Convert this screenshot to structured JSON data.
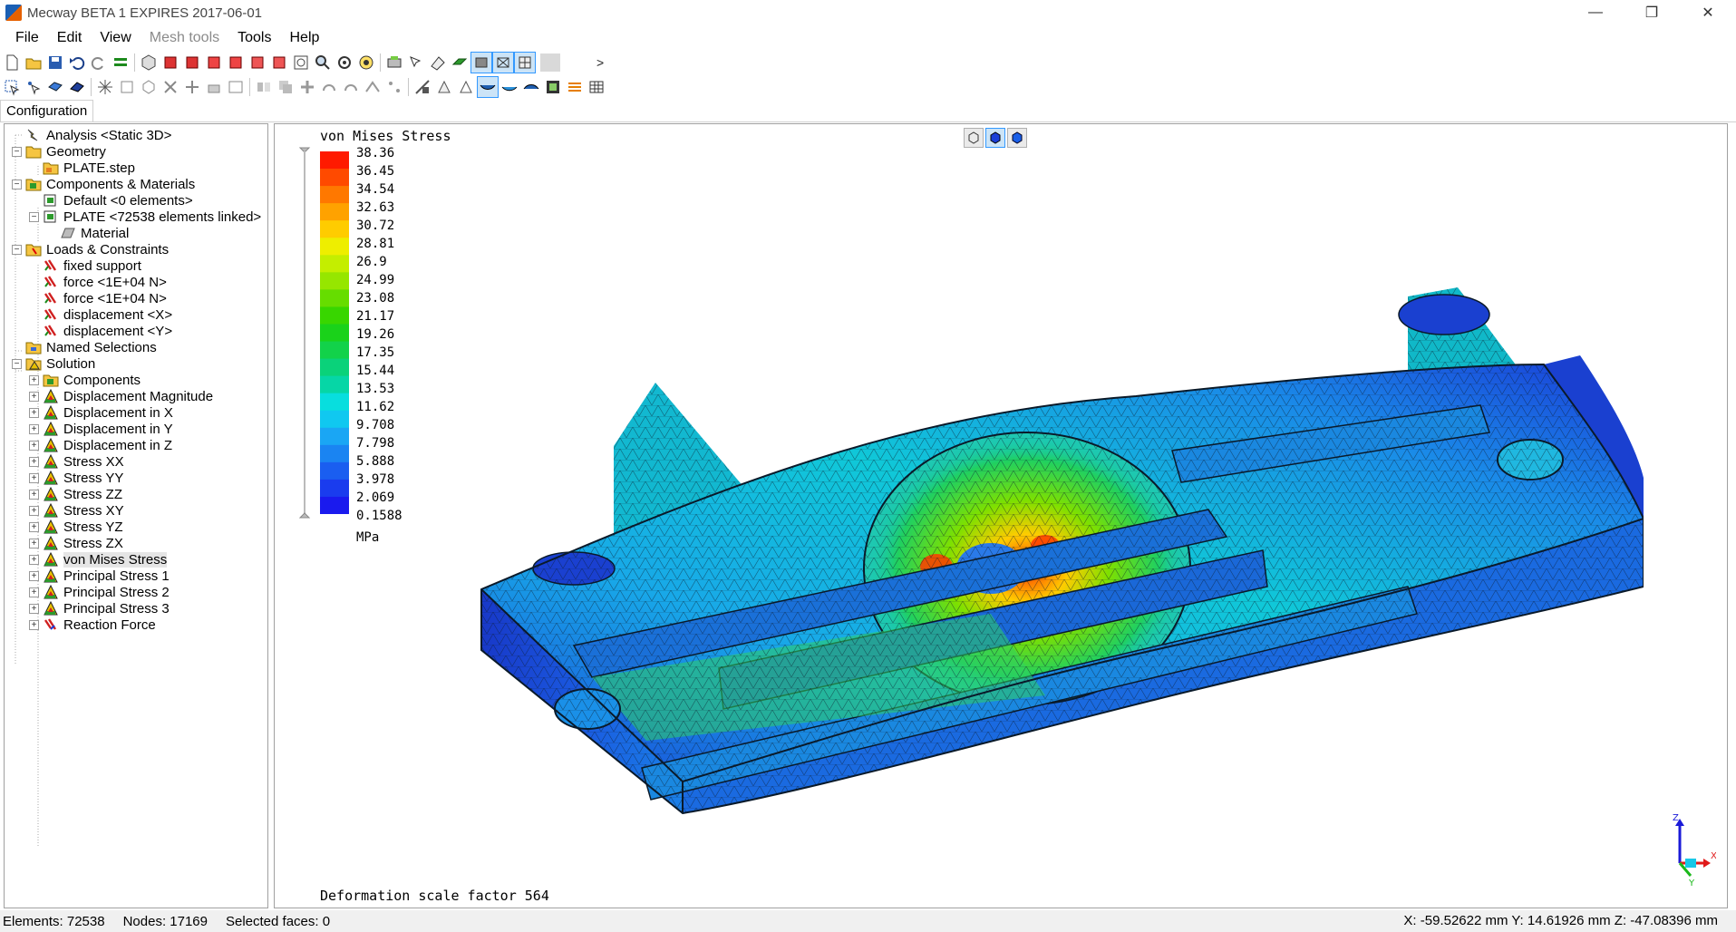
{
  "window": {
    "title": "Mecway BETA 1 EXPIRES 2017-06-01",
    "controls": [
      "—",
      "❐",
      "✕"
    ]
  },
  "menu": [
    {
      "label": "File",
      "enabled": true
    },
    {
      "label": "Edit",
      "enabled": true
    },
    {
      "label": "View",
      "enabled": true
    },
    {
      "label": "Mesh tools",
      "enabled": false
    },
    {
      "label": "Tools",
      "enabled": true
    },
    {
      "label": "Help",
      "enabled": true
    }
  ],
  "toolbar": {
    "scroll_right": ">",
    "scroll_left": "<"
  },
  "config_tab": "Configuration",
  "tree": [
    {
      "label": "Analysis <Static 3D>",
      "level": 1,
      "icon": "analysis-icon",
      "expander": ""
    },
    {
      "label": "Geometry",
      "level": 1,
      "icon": "folder-icon",
      "expander": "−"
    },
    {
      "label": "PLATE.step",
      "level": 2,
      "icon": "step-file-icon",
      "expander": ""
    },
    {
      "label": "Components & Materials",
      "level": 1,
      "icon": "components-icon",
      "expander": "−"
    },
    {
      "label": "Default <0 elements>",
      "level": 2,
      "icon": "component-icon",
      "expander": ""
    },
    {
      "label": "PLATE <72538 elements linked>",
      "level": 2,
      "icon": "component-icon",
      "expander": "−"
    },
    {
      "label": "Material",
      "level": 3,
      "icon": "material-icon",
      "expander": ""
    },
    {
      "label": "Loads & Constraints",
      "level": 1,
      "icon": "loads-icon",
      "expander": "−"
    },
    {
      "label": "fixed support",
      "level": 2,
      "icon": "constraint-icon",
      "expander": ""
    },
    {
      "label": "force <1E+04 N>",
      "level": 2,
      "icon": "force-icon",
      "expander": ""
    },
    {
      "label": "force <1E+04 N>",
      "level": 2,
      "icon": "force-icon",
      "expander": ""
    },
    {
      "label": "displacement <X>",
      "level": 2,
      "icon": "constraint-icon",
      "expander": ""
    },
    {
      "label": "displacement <Y>",
      "level": 2,
      "icon": "constraint-icon",
      "expander": ""
    },
    {
      "label": "Named Selections",
      "level": 1,
      "icon": "named-selection-icon",
      "expander": ""
    },
    {
      "label": "Solution",
      "level": 1,
      "icon": "solution-icon",
      "expander": "−"
    },
    {
      "label": "Components",
      "level": 2,
      "icon": "components-icon",
      "expander": "+"
    },
    {
      "label": "Displacement Magnitude",
      "level": 2,
      "icon": "result-icon",
      "expander": "+"
    },
    {
      "label": "Displacement in X",
      "level": 2,
      "icon": "result-icon",
      "expander": "+"
    },
    {
      "label": "Displacement in Y",
      "level": 2,
      "icon": "result-icon",
      "expander": "+"
    },
    {
      "label": "Displacement in Z",
      "level": 2,
      "icon": "result-icon",
      "expander": "+"
    },
    {
      "label": "Stress XX",
      "level": 2,
      "icon": "result-icon",
      "expander": "+"
    },
    {
      "label": "Stress YY",
      "level": 2,
      "icon": "result-icon",
      "expander": "+"
    },
    {
      "label": "Stress ZZ",
      "level": 2,
      "icon": "result-icon",
      "expander": "+"
    },
    {
      "label": "Stress XY",
      "level": 2,
      "icon": "result-icon",
      "expander": "+"
    },
    {
      "label": "Stress YZ",
      "level": 2,
      "icon": "result-icon",
      "expander": "+"
    },
    {
      "label": "Stress ZX",
      "level": 2,
      "icon": "result-icon",
      "expander": "+"
    },
    {
      "label": "von Mises Stress",
      "level": 2,
      "icon": "result-icon",
      "expander": "+",
      "selected": true
    },
    {
      "label": "Principal Stress 1",
      "level": 2,
      "icon": "result-icon",
      "expander": "+"
    },
    {
      "label": "Principal Stress 2",
      "level": 2,
      "icon": "result-icon",
      "expander": "+"
    },
    {
      "label": "Principal Stress 3",
      "level": 2,
      "icon": "result-icon",
      "expander": "+"
    },
    {
      "label": "Reaction Force",
      "level": 2,
      "icon": "reaction-force-icon",
      "expander": "+"
    }
  ],
  "viewport": {
    "result_title": "von Mises Stress",
    "unit": "MPa",
    "legend_values": [
      "38.36",
      "36.45",
      "34.54",
      "32.63",
      "30.72",
      "28.81",
      "26.9",
      "24.99",
      "23.08",
      "21.17",
      "19.26",
      "17.35",
      "15.44",
      "13.53",
      "11.62",
      "9.708",
      "7.798",
      "5.888",
      "3.978",
      "2.069",
      "0.1588"
    ],
    "legend_colors": [
      "#ff1a00",
      "#ff4a00",
      "#ff7800",
      "#ffa200",
      "#ffcc00",
      "#eeee00",
      "#c4ee00",
      "#96e600",
      "#66dd00",
      "#38d600",
      "#1ad21a",
      "#12d24a",
      "#0ad27a",
      "#06d6a6",
      "#08dede",
      "#10c8f0",
      "#1aa6f4",
      "#1a84f2",
      "#1a5ef0",
      "#1a3cee",
      "#1a1aee"
    ],
    "deformation_text": "Deformation scale factor 564",
    "axis_labels": {
      "z": "Z",
      "x": "X",
      "y": "Y"
    }
  },
  "status": {
    "elements": "Elements: 72538",
    "nodes": "Nodes: 17169",
    "selected_faces": "Selected faces: 0",
    "coordinates": "X: -59.52622 mm Y: 14.61926 mm Z: -47.08396 mm"
  }
}
